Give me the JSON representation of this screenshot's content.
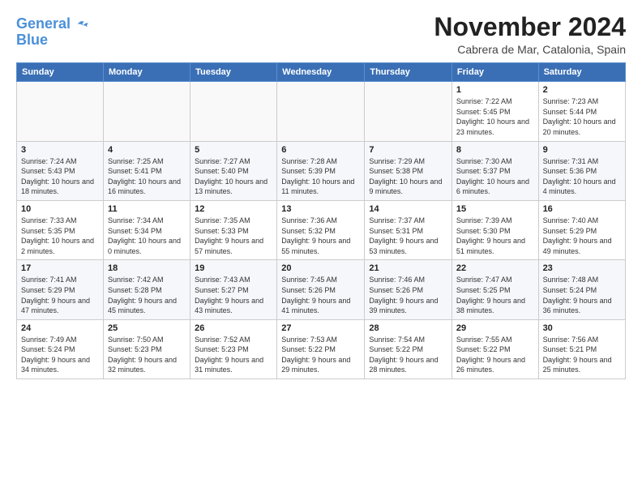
{
  "logo": {
    "line1": "General",
    "line2": "Blue"
  },
  "header": {
    "title": "November 2024",
    "subtitle": "Cabrera de Mar, Catalonia, Spain"
  },
  "days_of_week": [
    "Sunday",
    "Monday",
    "Tuesday",
    "Wednesday",
    "Thursday",
    "Friday",
    "Saturday"
  ],
  "weeks": [
    [
      {
        "day": "",
        "info": ""
      },
      {
        "day": "",
        "info": ""
      },
      {
        "day": "",
        "info": ""
      },
      {
        "day": "",
        "info": ""
      },
      {
        "day": "",
        "info": ""
      },
      {
        "day": "1",
        "info": "Sunrise: 7:22 AM\nSunset: 5:45 PM\nDaylight: 10 hours and 23 minutes."
      },
      {
        "day": "2",
        "info": "Sunrise: 7:23 AM\nSunset: 5:44 PM\nDaylight: 10 hours and 20 minutes."
      }
    ],
    [
      {
        "day": "3",
        "info": "Sunrise: 7:24 AM\nSunset: 5:43 PM\nDaylight: 10 hours and 18 minutes."
      },
      {
        "day": "4",
        "info": "Sunrise: 7:25 AM\nSunset: 5:41 PM\nDaylight: 10 hours and 16 minutes."
      },
      {
        "day": "5",
        "info": "Sunrise: 7:27 AM\nSunset: 5:40 PM\nDaylight: 10 hours and 13 minutes."
      },
      {
        "day": "6",
        "info": "Sunrise: 7:28 AM\nSunset: 5:39 PM\nDaylight: 10 hours and 11 minutes."
      },
      {
        "day": "7",
        "info": "Sunrise: 7:29 AM\nSunset: 5:38 PM\nDaylight: 10 hours and 9 minutes."
      },
      {
        "day": "8",
        "info": "Sunrise: 7:30 AM\nSunset: 5:37 PM\nDaylight: 10 hours and 6 minutes."
      },
      {
        "day": "9",
        "info": "Sunrise: 7:31 AM\nSunset: 5:36 PM\nDaylight: 10 hours and 4 minutes."
      }
    ],
    [
      {
        "day": "10",
        "info": "Sunrise: 7:33 AM\nSunset: 5:35 PM\nDaylight: 10 hours and 2 minutes."
      },
      {
        "day": "11",
        "info": "Sunrise: 7:34 AM\nSunset: 5:34 PM\nDaylight: 10 hours and 0 minutes."
      },
      {
        "day": "12",
        "info": "Sunrise: 7:35 AM\nSunset: 5:33 PM\nDaylight: 9 hours and 57 minutes."
      },
      {
        "day": "13",
        "info": "Sunrise: 7:36 AM\nSunset: 5:32 PM\nDaylight: 9 hours and 55 minutes."
      },
      {
        "day": "14",
        "info": "Sunrise: 7:37 AM\nSunset: 5:31 PM\nDaylight: 9 hours and 53 minutes."
      },
      {
        "day": "15",
        "info": "Sunrise: 7:39 AM\nSunset: 5:30 PM\nDaylight: 9 hours and 51 minutes."
      },
      {
        "day": "16",
        "info": "Sunrise: 7:40 AM\nSunset: 5:29 PM\nDaylight: 9 hours and 49 minutes."
      }
    ],
    [
      {
        "day": "17",
        "info": "Sunrise: 7:41 AM\nSunset: 5:29 PM\nDaylight: 9 hours and 47 minutes."
      },
      {
        "day": "18",
        "info": "Sunrise: 7:42 AM\nSunset: 5:28 PM\nDaylight: 9 hours and 45 minutes."
      },
      {
        "day": "19",
        "info": "Sunrise: 7:43 AM\nSunset: 5:27 PM\nDaylight: 9 hours and 43 minutes."
      },
      {
        "day": "20",
        "info": "Sunrise: 7:45 AM\nSunset: 5:26 PM\nDaylight: 9 hours and 41 minutes."
      },
      {
        "day": "21",
        "info": "Sunrise: 7:46 AM\nSunset: 5:26 PM\nDaylight: 9 hours and 39 minutes."
      },
      {
        "day": "22",
        "info": "Sunrise: 7:47 AM\nSunset: 5:25 PM\nDaylight: 9 hours and 38 minutes."
      },
      {
        "day": "23",
        "info": "Sunrise: 7:48 AM\nSunset: 5:24 PM\nDaylight: 9 hours and 36 minutes."
      }
    ],
    [
      {
        "day": "24",
        "info": "Sunrise: 7:49 AM\nSunset: 5:24 PM\nDaylight: 9 hours and 34 minutes."
      },
      {
        "day": "25",
        "info": "Sunrise: 7:50 AM\nSunset: 5:23 PM\nDaylight: 9 hours and 32 minutes."
      },
      {
        "day": "26",
        "info": "Sunrise: 7:52 AM\nSunset: 5:23 PM\nDaylight: 9 hours and 31 minutes."
      },
      {
        "day": "27",
        "info": "Sunrise: 7:53 AM\nSunset: 5:22 PM\nDaylight: 9 hours and 29 minutes."
      },
      {
        "day": "28",
        "info": "Sunrise: 7:54 AM\nSunset: 5:22 PM\nDaylight: 9 hours and 28 minutes."
      },
      {
        "day": "29",
        "info": "Sunrise: 7:55 AM\nSunset: 5:22 PM\nDaylight: 9 hours and 26 minutes."
      },
      {
        "day": "30",
        "info": "Sunrise: 7:56 AM\nSunset: 5:21 PM\nDaylight: 9 hours and 25 minutes."
      }
    ]
  ]
}
